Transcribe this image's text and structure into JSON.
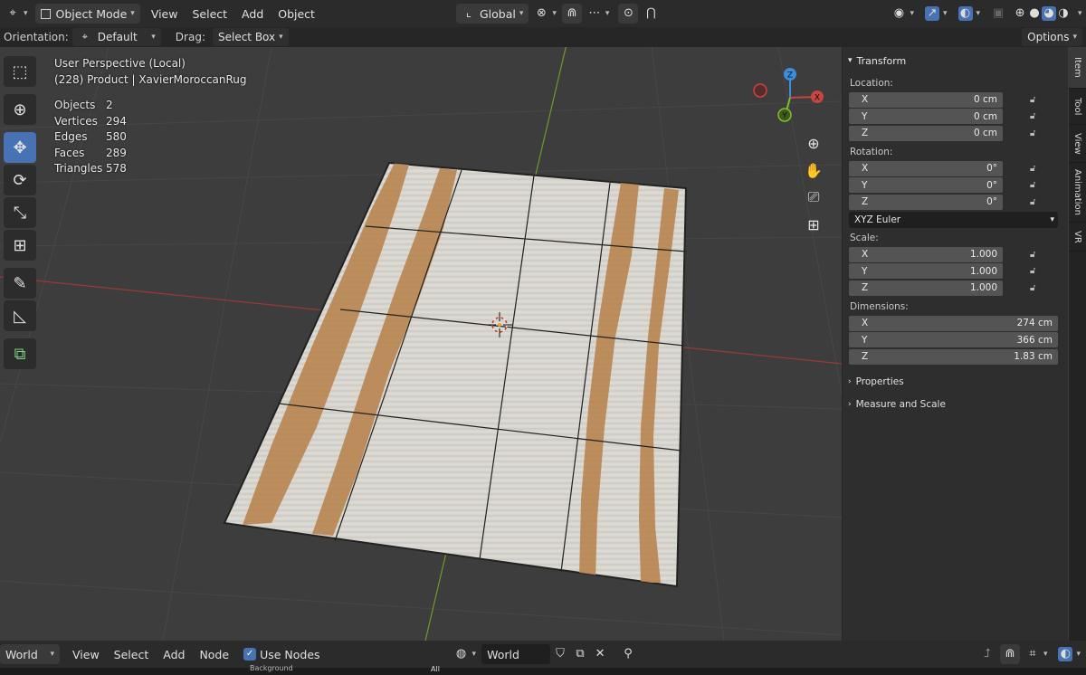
{
  "header": {
    "mode": "Object Mode",
    "menus": [
      "View",
      "Select",
      "Add",
      "Object"
    ],
    "transform_orientation": "Global"
  },
  "tool_settings": {
    "orientation_label": "Orientation:",
    "orientation_value": "Default",
    "drag_label": "Drag:",
    "drag_value": "Select Box",
    "options_label": "Options"
  },
  "viewport": {
    "view_name": "User Perspective (Local)",
    "object_info": "(228) Product | XavierMoroccanRug",
    "stats": [
      {
        "key": "Objects",
        "value": "2"
      },
      {
        "key": "Vertices",
        "value": "294"
      },
      {
        "key": "Edges",
        "value": "580"
      },
      {
        "key": "Faces",
        "value": "289"
      },
      {
        "key": "Triangles",
        "value": "578"
      }
    ],
    "gizmo_axes": {
      "x": "X",
      "y": "Y",
      "z": "Z"
    }
  },
  "tools": [
    {
      "name": "select-box-tool-icon",
      "glyph": "⬚",
      "active": false
    },
    {
      "name": "cursor-tool-icon",
      "glyph": "⊕",
      "active": false
    },
    {
      "name": "move-tool-icon",
      "glyph": "✥",
      "active": true
    },
    {
      "name": "rotate-tool-icon",
      "glyph": "⟳",
      "active": false
    },
    {
      "name": "scale-tool-icon",
      "glyph": "⤡",
      "active": false
    },
    {
      "name": "transform-tool-icon",
      "glyph": "⊞",
      "active": false
    },
    {
      "name": "annotate-tool-icon",
      "glyph": "✎",
      "active": false
    },
    {
      "name": "measure-tool-icon",
      "glyph": "◺",
      "active": false
    },
    {
      "name": "add-cube-tool-icon",
      "glyph": "⧉",
      "active": false
    }
  ],
  "panel": {
    "transform_title": "Transform",
    "location_label": "Location:",
    "location": [
      {
        "axis": "X",
        "value": "0 cm"
      },
      {
        "axis": "Y",
        "value": "0 cm"
      },
      {
        "axis": "Z",
        "value": "0 cm"
      }
    ],
    "rotation_label": "Rotation:",
    "rotation": [
      {
        "axis": "X",
        "value": "0°"
      },
      {
        "axis": "Y",
        "value": "0°"
      },
      {
        "axis": "Z",
        "value": "0°"
      }
    ],
    "rotation_mode": "XYZ Euler",
    "scale_label": "Scale:",
    "scale": [
      {
        "axis": "X",
        "value": "1.000"
      },
      {
        "axis": "Y",
        "value": "1.000"
      },
      {
        "axis": "Z",
        "value": "1.000"
      }
    ],
    "dimensions_label": "Dimensions:",
    "dimensions": [
      {
        "axis": "X",
        "value": "274 cm"
      },
      {
        "axis": "Y",
        "value": "366 cm"
      },
      {
        "axis": "Z",
        "value": "1.83 cm"
      }
    ],
    "properties_label": "Properties",
    "measure_label": "Measure and Scale"
  },
  "side_tabs": [
    "Item",
    "Tool",
    "View",
    "Animation",
    "VR"
  ],
  "bottom": {
    "editor": "World",
    "menus": [
      "View",
      "Select",
      "Add",
      "Node"
    ],
    "use_nodes_label": "Use Nodes",
    "world_name": "World",
    "strip_left": "Background",
    "strip_mid": "All"
  },
  "colors": {
    "accent": "#4772b3",
    "axis_x": "#c7463f",
    "axis_y": "#7fbf2a",
    "axis_z": "#3b8ed8",
    "rug_base": "#d9d6cf",
    "rug_stripe": "#b98550"
  }
}
